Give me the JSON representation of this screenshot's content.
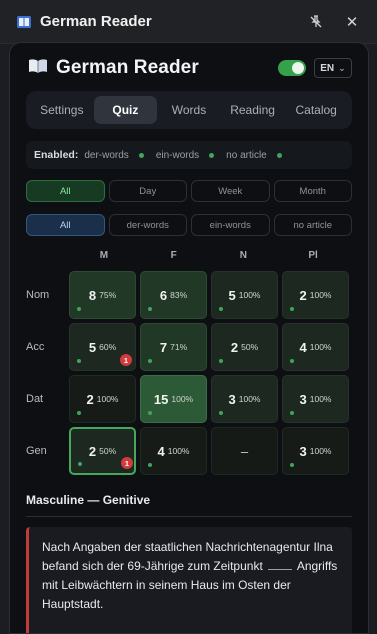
{
  "chrome": {
    "title": "German Reader"
  },
  "header": {
    "title": "German Reader",
    "lang": "EN",
    "enabled_on": true
  },
  "tabs": [
    {
      "label": "Settings"
    },
    {
      "label": "Quiz",
      "active": true
    },
    {
      "label": "Words"
    },
    {
      "label": "Reading"
    },
    {
      "label": "Catalog"
    }
  ],
  "enabled": {
    "label": "Enabled:",
    "items": [
      "der-words",
      "ein-words",
      "no article"
    ]
  },
  "time_filters": [
    "All",
    "Day",
    "Week",
    "Month"
  ],
  "type_filters": [
    "All",
    "der-words",
    "ein-words",
    "no article"
  ],
  "grid": {
    "columns": [
      "M",
      "F",
      "N",
      "Pl"
    ],
    "rows": [
      {
        "label": "Nom",
        "cells": [
          {
            "n": "8",
            "p": "75%"
          },
          {
            "n": "6",
            "p": "83%"
          },
          {
            "n": "5",
            "p": "100%"
          },
          {
            "n": "2",
            "p": "100%"
          }
        ]
      },
      {
        "label": "Acc",
        "cells": [
          {
            "n": "5",
            "p": "60%",
            "badge": "1"
          },
          {
            "n": "7",
            "p": "71%"
          },
          {
            "n": "2",
            "p": "50%"
          },
          {
            "n": "4",
            "p": "100%"
          }
        ]
      },
      {
        "label": "Dat",
        "cells": [
          {
            "n": "2",
            "p": "100%"
          },
          {
            "n": "15",
            "p": "100%"
          },
          {
            "n": "3",
            "p": "100%"
          },
          {
            "n": "3",
            "p": "100%"
          }
        ]
      },
      {
        "label": "Gen",
        "cells": [
          {
            "n": "2",
            "p": "50%",
            "badge": "1"
          },
          {
            "n": "4",
            "p": "100%"
          },
          {
            "n": "–",
            "p": ""
          },
          {
            "n": "3",
            "p": "100%"
          }
        ]
      }
    ]
  },
  "section_title": "Masculine — Genitive",
  "sentence": {
    "before": "Nach Angaben der staatlichen Nachrichtenagentur Ilna befand sich der 69-Jährige zum Zeitpunkt",
    "blank": "___",
    "after": "Angriffs mit Leibwächtern in seinem Haus im Osten der Hauptstadt."
  }
}
